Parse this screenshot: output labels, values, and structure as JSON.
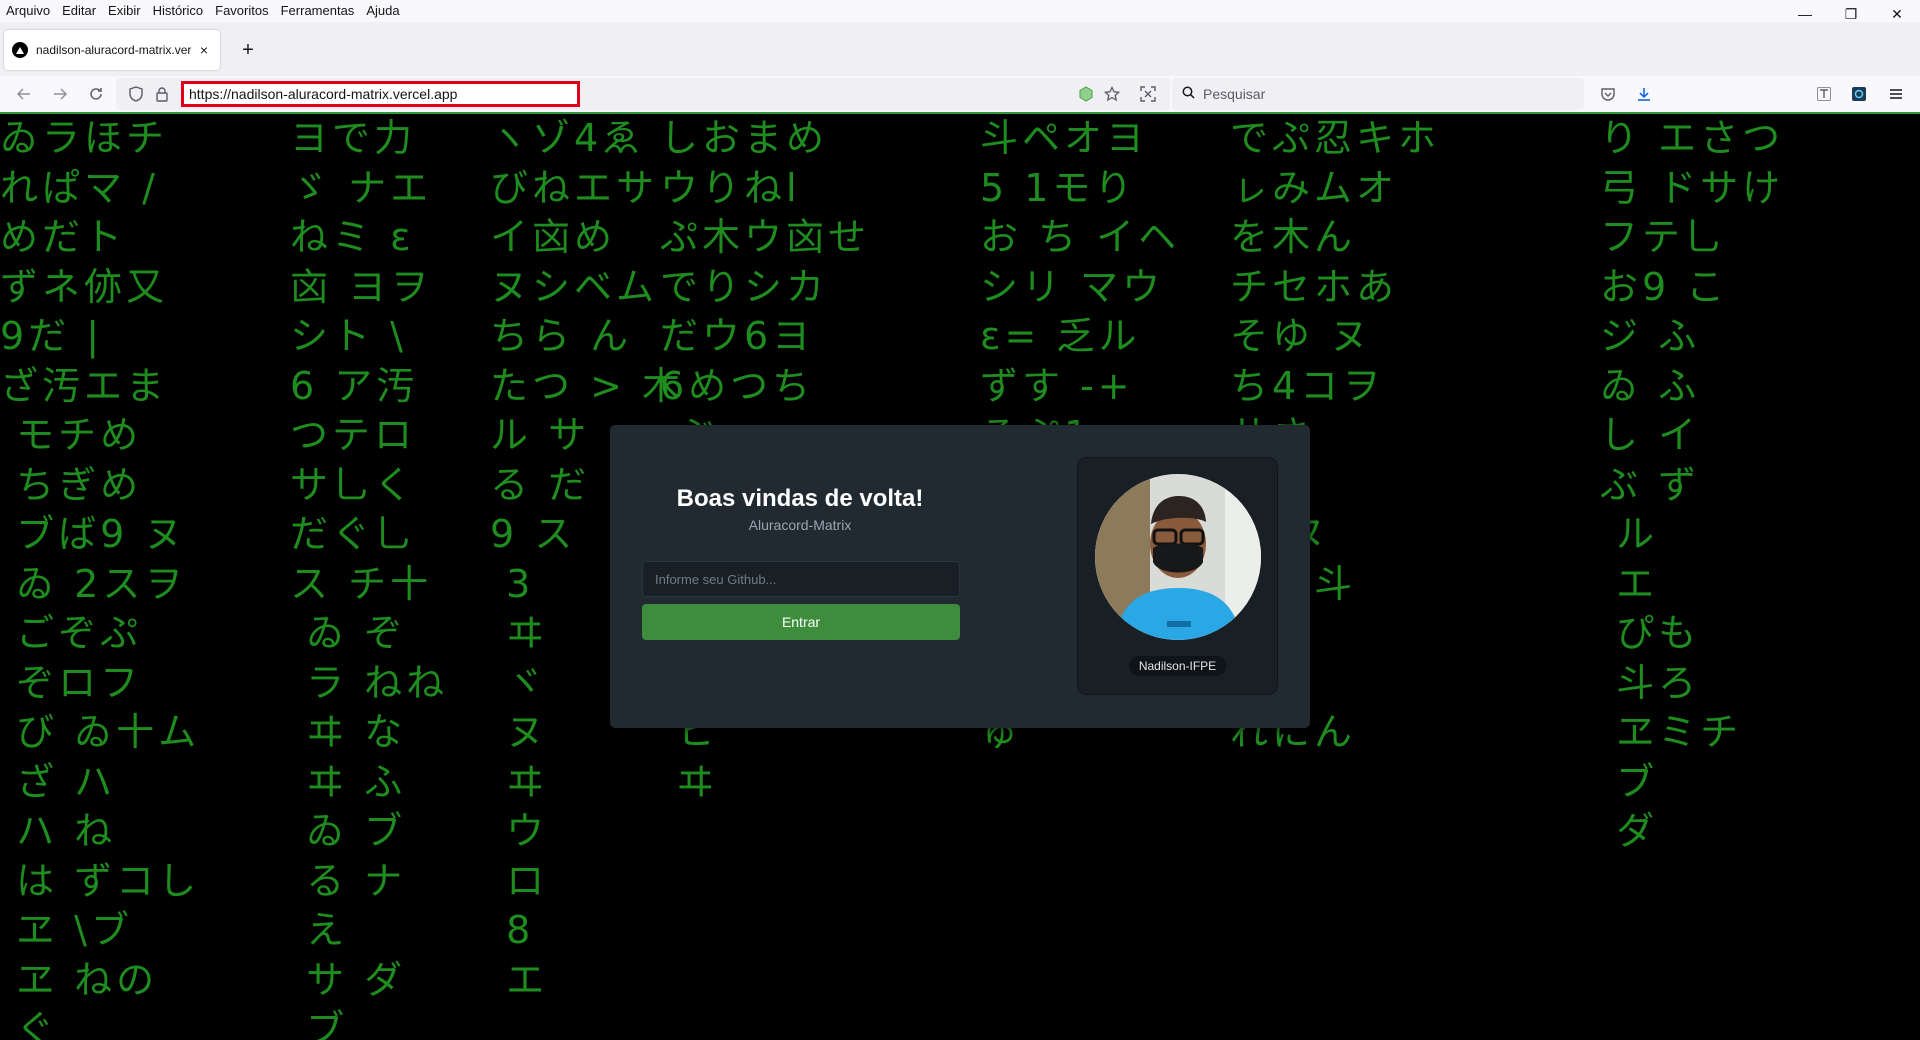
{
  "browser": {
    "menu": [
      "Arquivo",
      "Editar",
      "Exibir",
      "Histórico",
      "Favoritos",
      "Ferramentas",
      "Ajuda"
    ],
    "tab": {
      "title": "nadilson-aluracord-matrix.verc",
      "close_glyph": "×"
    },
    "new_tab_glyph": "+",
    "url": "https://nadilson-aluracord-matrix.vercel.app",
    "search_placeholder": "Pesquisar",
    "window_controls": [
      "—",
      "❐",
      "✕"
    ],
    "accent_color": "#2b9a3b",
    "icons": [
      "back-icon",
      "forward-icon",
      "reload-icon",
      "shield-icon",
      "lock-icon",
      "extension-icon",
      "star-icon",
      "screenshot-icon",
      "search-icon",
      "pocket-icon",
      "download-icon",
      "reader-icon",
      "extension-icon-2",
      "menu-icon"
    ]
  },
  "matrix": {
    "color": "#1e8c1e",
    "columns": [
      "ゐラほチ\nれぱマ /\nめだト\nずネ㑊又\n9だ |\nざ汚エま\n モチめ\n ちぎめ\n ブば9 ヌ\n ゐ 2スヲ\n ごぞぷ\n ぞロフ\n び ゐ十ム\n ざ ハ\n ハ ね\n は ずコし\n ヱ \\ブ\n ヱ ねの\n ぐ",
      "ヨで力\nゞ ナエ\nねミ ε\n㐫 ヨヲ\nシト \\\n6 ア汚\nつテロ\nサ乚く\nだぐ乚\nス チ十\n ゐ ぞ\n ラ ねね\n ヰ な\n ヰ ふ\n ゐ ブ\n る ナ\n え\n サ ダ\n ブ",
      "ヽゾ4ゑ\nびねエサ\nイ㐫め\nヌシベム\nちら ん\nたつ > 木\nル サ\nる だ\n9 ス\n 3\n ヰ\n ヾ\n ヌ\n ヰ\n ウ\n ロ\n 8\n エ",
      "しおまめ\nウりねl\nぷ木ウ㐫せ\nでりシカ\nだウ6ヨ\n6めつち\n ぶ\n ヲ\n ス\n ヾ\n ヨ\n ロ\n ヒ\n ヰ",
      "斗ペオヨ\n5 1モり\nお ち イヘ\nシリ マウ\nε= 乏ル\nずす -+\nろぷ1\nヤ ヘ\nロムス\n9モひ\n乚 せ\n乚おし\nゅ",
      "でぷ忍キホ\nㇾみムオ\nを木ん\nチセホあ\nそゆ ヌ\nち4コヲ\nサさ\nへホ\nフ ヌ\nホホ斗\nてホ\nさム\nれにん",
      "り エさつ\n弓 ドサけ\nフテ乚\nお9 こ\nジ ふ\nゐ ふ\nし イ\nぶ ず\n ル\n エ\n ぴも\n 斗ろ\n ヱミチ\n ブ\n ダ"
    ]
  },
  "card": {
    "title": "Boas vindas de volta!",
    "subtitle": "Aluracord-Matrix",
    "input_placeholder": "Informe seu Github...",
    "button_label": "Entrar",
    "username": "Nadilson-IFPE",
    "button_color": "#3d8d3d"
  }
}
